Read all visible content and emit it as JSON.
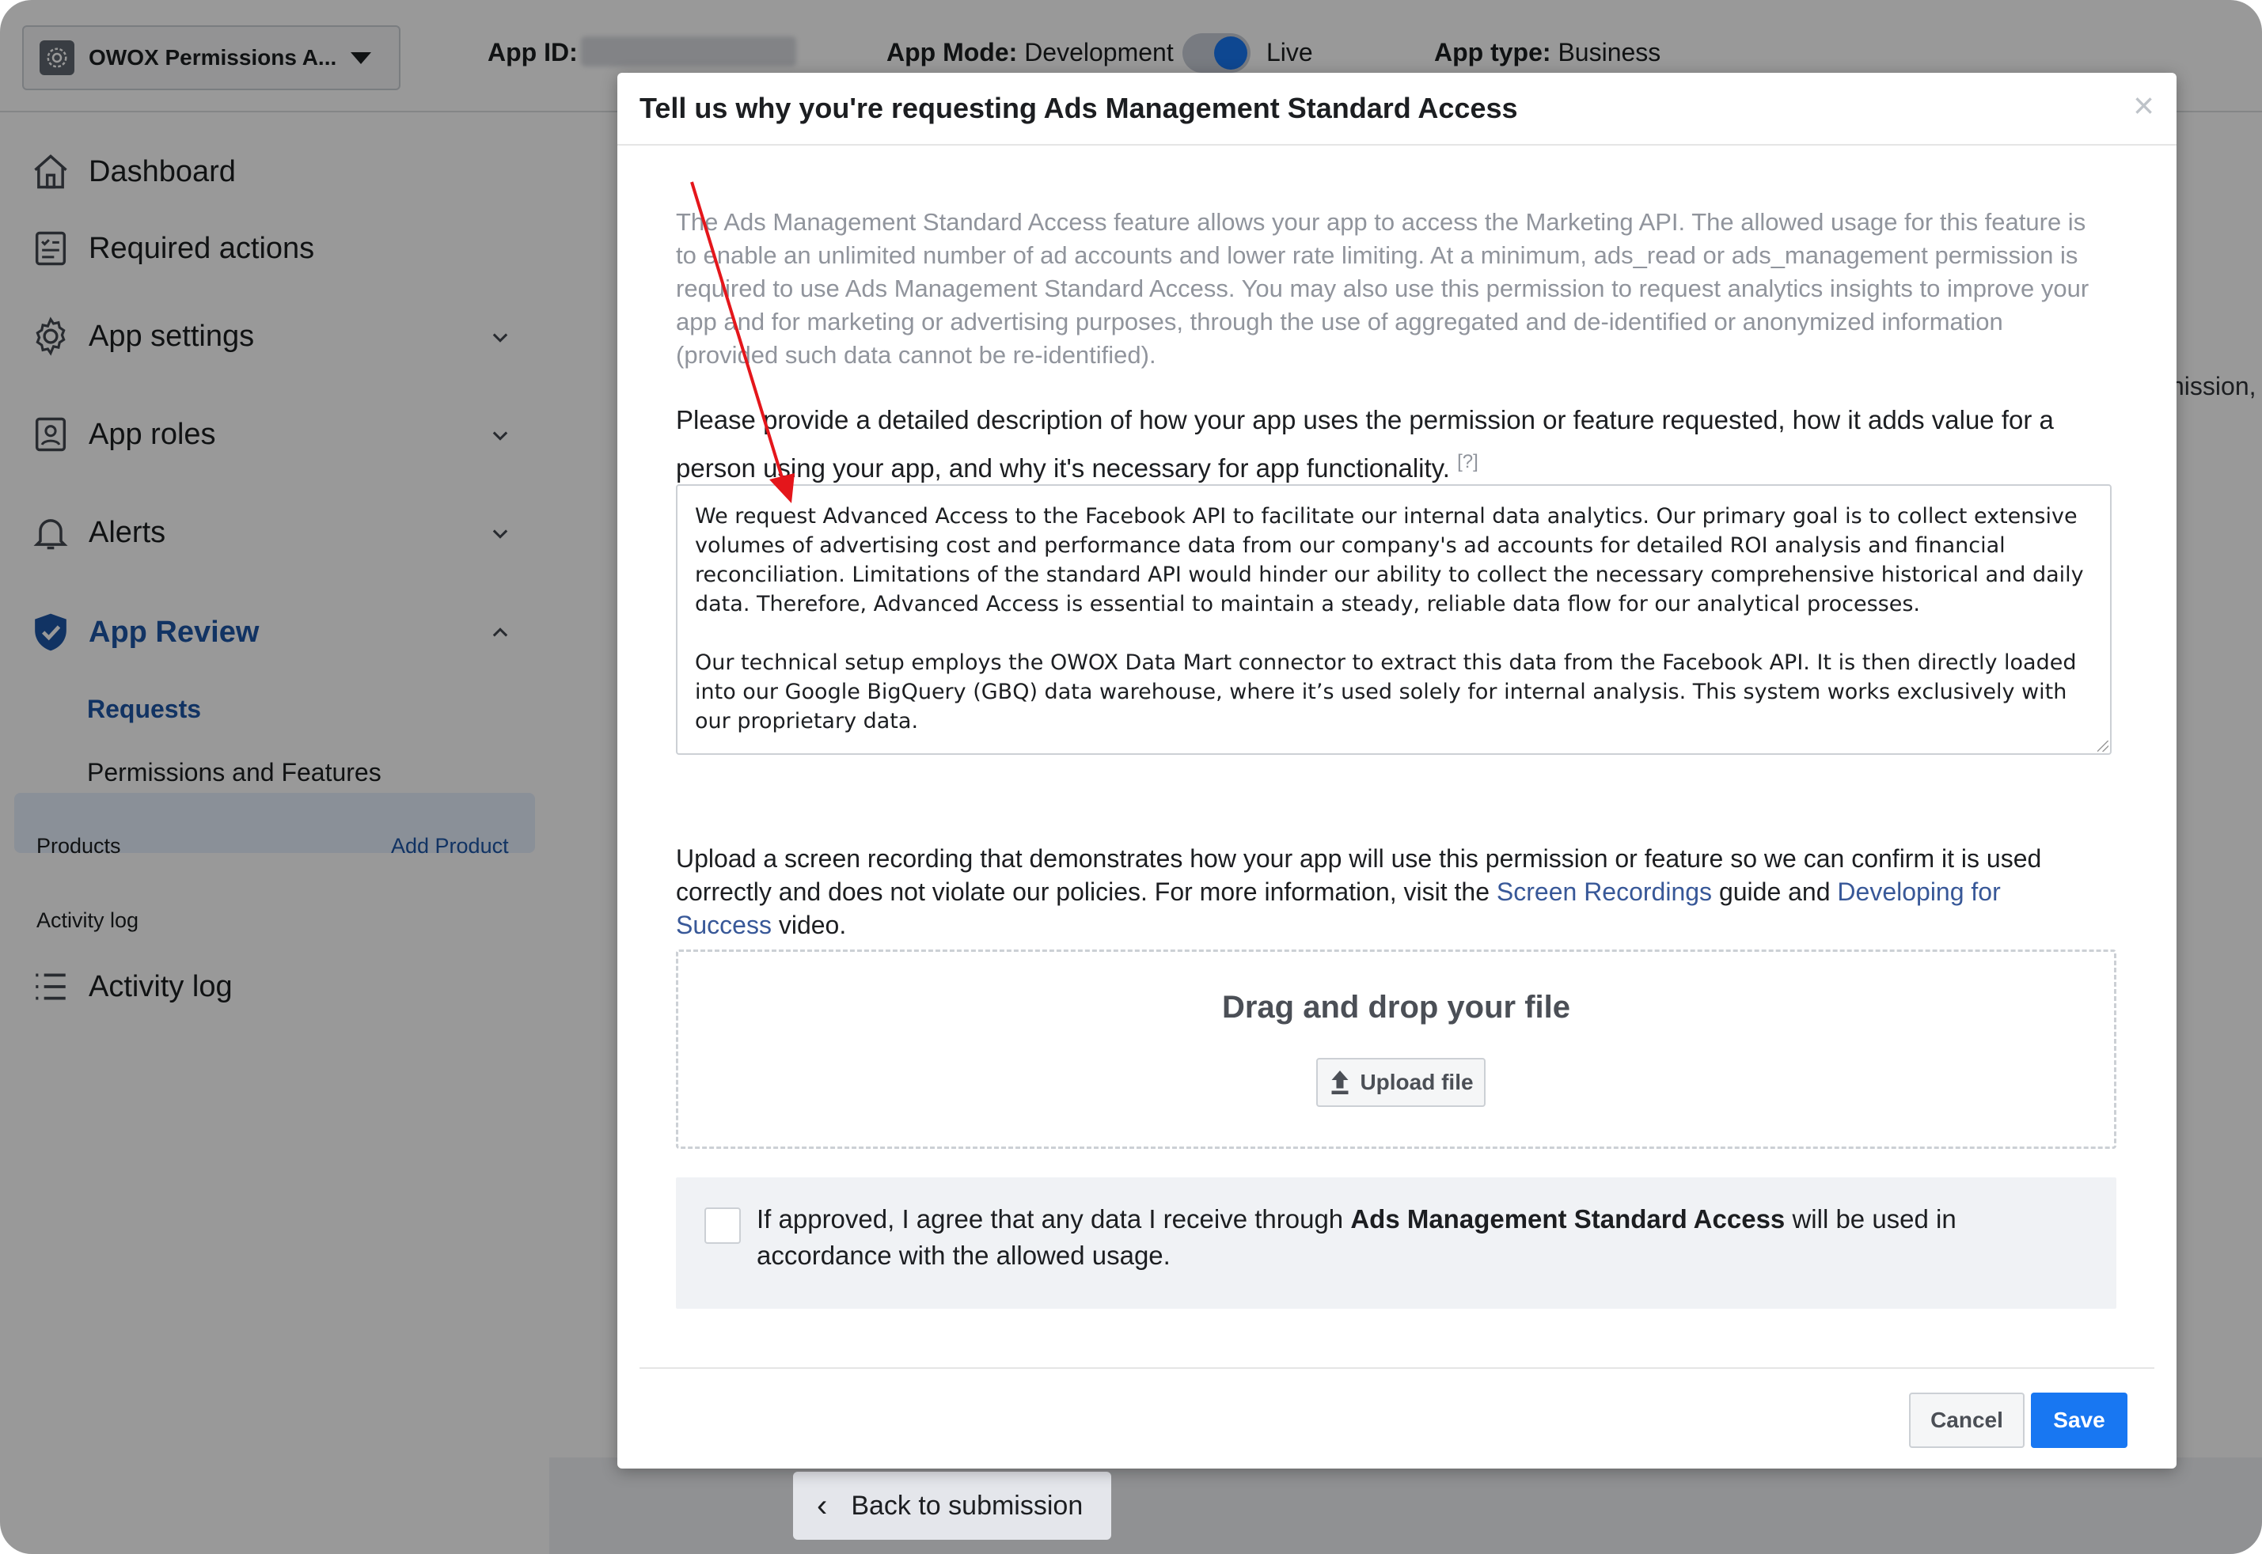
{
  "topbar": {
    "app_name": "OWOX Permissions A...",
    "app_id_label": "App ID:",
    "app_mode_label": "App Mode:",
    "app_mode_dev": "Development",
    "app_mode_live": "Live",
    "app_type_label": "App type:",
    "app_type_value": "Business"
  },
  "sidebar": {
    "items": [
      {
        "label": "Dashboard",
        "icon": "home-icon"
      },
      {
        "label": "Required actions",
        "icon": "checklist-icon"
      },
      {
        "label": "App settings",
        "icon": "gear-icon"
      },
      {
        "label": "App roles",
        "icon": "id-badge-icon"
      },
      {
        "label": "Alerts",
        "icon": "bell-icon"
      },
      {
        "label": "App Review",
        "icon": "shield-icon"
      }
    ],
    "sub_items": [
      "Requests",
      "Permissions and Features"
    ],
    "products_label": "Products",
    "add_product": "Add Product",
    "activity_section": "Activity log",
    "activity_item": "Activity log"
  },
  "background": {
    "back_button": "Back to submission",
    "ghost_text": "nission,"
  },
  "modal": {
    "title": "Tell us why you're requesting Ads Management Standard Access",
    "close_label": "×",
    "description": "The Ads Management Standard Access feature allows your app to access the Marketing API. The allowed usage for this feature is to enable an unlimited number of ad accounts and lower rate limiting. At a minimum, ads_read or ads_management permission is required to use Ads Management Standard Access. You may also use this permission to request analytics insights to improve your app and for marketing or advertising purposes, through the use of aggregated and de-identified or anonymized information (provided such data cannot be re-identified).",
    "prompt": "Please provide a detailed description of how your app uses the permission or feature requested, how it adds value for a person using your app, and why it's necessary for app functionality.",
    "prompt_help": "[?]",
    "textarea_value": "We request Advanced Access to the Facebook API to facilitate our internal data analytics. Our primary goal is to collect extensive volumes of advertising cost and performance data from our company's ad accounts for detailed ROI analysis and financial reconciliation. Limitations of the standard API would hinder our ability to collect the necessary comprehensive historical and daily data. Therefore, Advanced Access is essential to maintain a steady, reliable data flow for our analytical processes.\n\nOur technical setup employs the OWOX Data Mart connector to extract this data from the Facebook API. It is then directly loaded into our Google BigQuery (GBQ) data warehouse, where it’s used solely for internal analysis. This system works exclusively with our proprietary data.",
    "upload_text_1": "Upload a screen recording that demonstrates how your app will use this permission or feature so we can confirm it is used correctly and does not violate our policies. For more information, visit the ",
    "upload_link_1": "Screen Recordings",
    "upload_text_2": " guide and ",
    "upload_link_2": "Developing for Success",
    "upload_text_3": " video.",
    "dropzone_title": "Drag and drop your file",
    "upload_button": "Upload file",
    "agree_prefix": "If approved, I agree that any data I receive through ",
    "agree_bold": "Ads Management Standard Access",
    "agree_suffix": " will be used in accordance with the allowed usage.",
    "cancel_label": "Cancel",
    "save_label": "Save"
  },
  "colors": {
    "accent": "#1877f2",
    "link": "#385898",
    "nav_active": "#1d55a5",
    "annotation_arrow": "#e4161b"
  }
}
